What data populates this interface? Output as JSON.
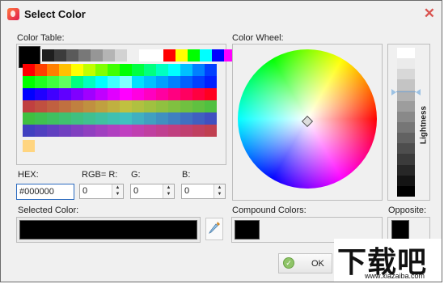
{
  "window": {
    "title": "Select Color",
    "close_glyph": "✕"
  },
  "color_table": {
    "label": "Color Table:",
    "selected": "#000000",
    "grays": [
      "#1e1e1e",
      "#3c3c3c",
      "#5a5a5a",
      "#787878",
      "#969696",
      "#b4b4b4",
      "#d2d2d2",
      "#f0f0f0",
      "#ffffff",
      "#ffffff",
      "#ff0000",
      "#ffff00",
      "#00ff00",
      "#00ffff",
      "#0000ff",
      "#ff00ff"
    ],
    "rows": [
      [
        "#ff0000",
        "#ff4000",
        "#ff8000",
        "#ffc000",
        "#ffff00",
        "#c0ff00",
        "#80ff00",
        "#40ff00",
        "#00ff00",
        "#00ff40",
        "#00ff80",
        "#00ffc0",
        "#00ffff",
        "#00c0ff",
        "#0080ff",
        "#0040ff"
      ],
      [
        "#00ff00",
        "#20ff20",
        "#40ff40",
        "#60ff60",
        "#00ff80",
        "#00ffc0",
        "#00ffff",
        "#40ffff",
        "#80ffff",
        "#00e0ff",
        "#00c0ff",
        "#00a0ff",
        "#0080ff",
        "#0060ff",
        "#0040ff",
        "#0020ff"
      ],
      [
        "#0000ff",
        "#2000ff",
        "#4000ff",
        "#6000ff",
        "#8000ff",
        "#a000ff",
        "#c000ff",
        "#e000ff",
        "#ff00ff",
        "#ff00e0",
        "#ff00c0",
        "#ff00a0",
        "#ff0080",
        "#ff0060",
        "#ff0040",
        "#ff0020"
      ],
      [
        "#c04040",
        "#c05040",
        "#c06040",
        "#c07040",
        "#c08040",
        "#c09040",
        "#c0a040",
        "#c0b040",
        "#c0c040",
        "#b0c040",
        "#a0c040",
        "#90c040",
        "#80c040",
        "#70c040",
        "#60c040",
        "#50c040"
      ],
      [
        "#40c040",
        "#40c050",
        "#40c060",
        "#40c070",
        "#40c080",
        "#40c090",
        "#40c0a0",
        "#40c0b0",
        "#40c0c0",
        "#40b0c0",
        "#40a0c0",
        "#4090c0",
        "#4080c0",
        "#4070c0",
        "#4060c0",
        "#4050c0"
      ],
      [
        "#4040c0",
        "#5040c0",
        "#6040c0",
        "#7040c0",
        "#8040c0",
        "#9040c0",
        "#a040c0",
        "#b040c0",
        "#c040c0",
        "#c040b0",
        "#c040a0",
        "#c04090",
        "#c04080",
        "#c04070",
        "#c04060",
        "#c04050"
      ]
    ],
    "custom": [
      "#ffd580"
    ]
  },
  "color_wheel": {
    "label": "Color Wheel:"
  },
  "lightness": {
    "label": "Lightness"
  },
  "fields": {
    "hex_label": "HEX:",
    "hex_value": "#000000",
    "rgb_r_label": "RGB= R:",
    "r_value": "0",
    "g_label": "G:",
    "g_value": "0",
    "b_label": "B:",
    "b_value": "0"
  },
  "selected_color": {
    "label": "Selected Color:",
    "value": "#000000"
  },
  "compound_colors": {
    "label": "Compound Colors:",
    "value": "#000000"
  },
  "opposite": {
    "label": "Opposite:",
    "value": "#000000"
  },
  "ok_button": {
    "label": "OK"
  },
  "watermark": {
    "text": "下载吧",
    "url": "www.xiazaiba.com"
  }
}
